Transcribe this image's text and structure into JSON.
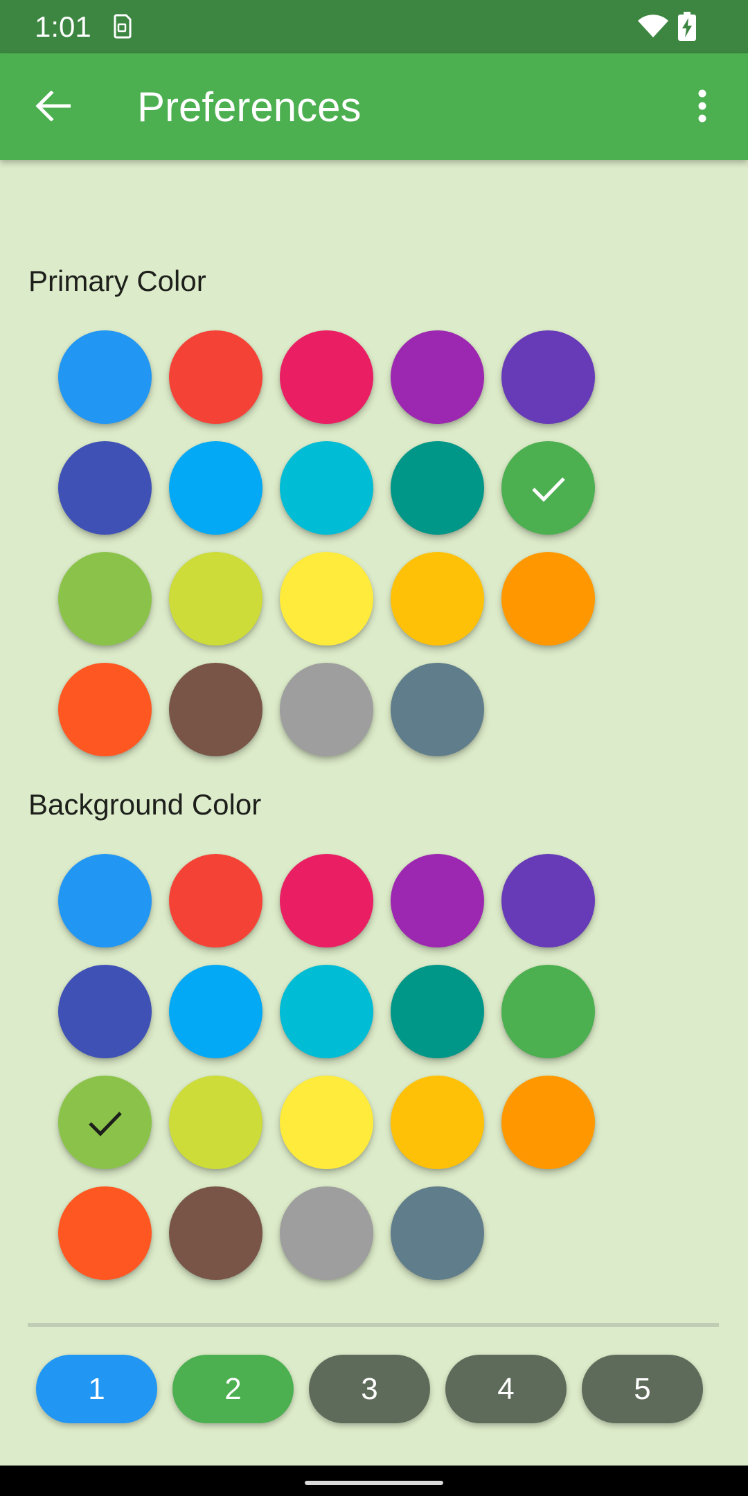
{
  "status_bar": {
    "time": "1:01",
    "icons": [
      "sim-icon",
      "wifi-icon",
      "battery-charging-icon"
    ]
  },
  "app_bar": {
    "title": "Preferences",
    "back_icon": "arrow-back-icon",
    "menu_icon": "more-vert-icon",
    "color": "#4caf50"
  },
  "primary_section": {
    "label": "Primary Color",
    "selected_color": "#4caf50",
    "swatches": [
      "#2196f3",
      "#f44336",
      "#e91e63",
      "#9c27b0",
      "#673ab7",
      "#3f51b5",
      "#03a9f4",
      "#00bcd4",
      "#009688",
      "#4caf50",
      "#8bc34a",
      "#cddc39",
      "#ffeb3b",
      "#ffc107",
      "#ff9800",
      "#ff5722",
      "#795548",
      "#9e9e9e",
      "#607d8b"
    ]
  },
  "background_section": {
    "label": "Background Color",
    "selected_color": "#8bc34a",
    "swatches": [
      "#2196f3",
      "#f44336",
      "#e91e63",
      "#9c27b0",
      "#673ab7",
      "#3f51b5",
      "#03a9f4",
      "#00bcd4",
      "#009688",
      "#4caf50",
      "#8bc34a",
      "#cddc39",
      "#ffeb3b",
      "#ffc107",
      "#ff9800",
      "#ff5722",
      "#795548",
      "#9e9e9e",
      "#607d8b"
    ]
  },
  "pager": {
    "buttons": [
      {
        "label": "1",
        "color": "#2196f3"
      },
      {
        "label": "2",
        "color": "#4caf50"
      },
      {
        "label": "3",
        "color": "#5e6b5a"
      },
      {
        "label": "4",
        "color": "#5e6b5a"
      },
      {
        "label": "5",
        "color": "#5e6b5a"
      }
    ]
  },
  "colors": {
    "background": "#dcebc9",
    "status_bar": "#3c8641",
    "divider": "#c0ccb3"
  }
}
